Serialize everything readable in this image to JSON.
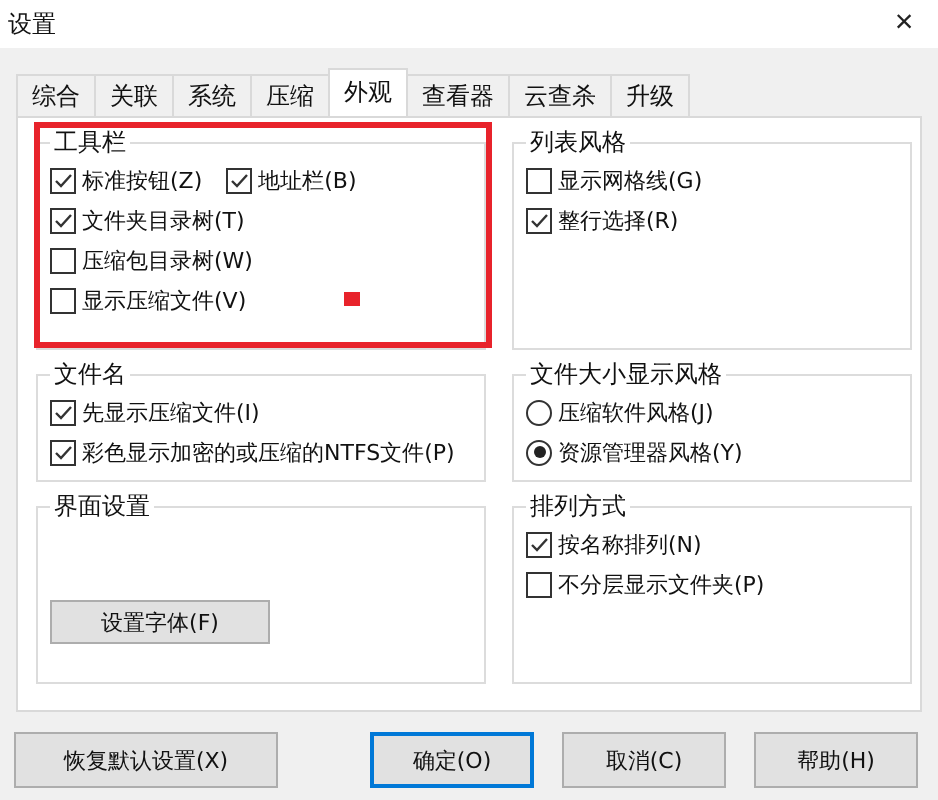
{
  "window": {
    "title": "设置",
    "close": "×"
  },
  "tabs": [
    {
      "label": "综合",
      "selected": false
    },
    {
      "label": "关联",
      "selected": false
    },
    {
      "label": "系统",
      "selected": false
    },
    {
      "label": "压缩",
      "selected": false
    },
    {
      "label": "外观",
      "selected": true
    },
    {
      "label": "查看器",
      "selected": false
    },
    {
      "label": "云查杀",
      "selected": false
    },
    {
      "label": "升级",
      "selected": false
    }
  ],
  "groups": [
    {
      "title": "工具栏",
      "kind": "checks",
      "rows": [
        [
          {
            "label": "标准按钮(Z)",
            "checked": true
          },
          {
            "label": "地址栏(B)",
            "checked": true
          }
        ],
        [
          {
            "label": "文件夹目录树(T)",
            "checked": true
          }
        ],
        [
          {
            "label": "压缩包目录树(W)",
            "checked": false
          }
        ],
        [
          {
            "label": "显示压缩文件(V)",
            "checked": false
          }
        ]
      ]
    },
    {
      "title": "列表风格",
      "kind": "checks",
      "rows": [
        [
          {
            "label": "显示网格线(G)",
            "checked": false
          }
        ],
        [
          {
            "label": "整行选择(R)",
            "checked": true
          }
        ]
      ]
    },
    {
      "title": "文件名",
      "kind": "checks",
      "rows": [
        [
          {
            "label": "先显示压缩文件(I)",
            "checked": true
          }
        ],
        [
          {
            "label": "彩色显示加密的或压缩的NTFS文件(P)",
            "checked": true
          }
        ]
      ]
    },
    {
      "title": "文件大小显示风格",
      "kind": "radios",
      "rows": [
        [
          {
            "label": "压缩软件风格(J)",
            "selected": false
          }
        ],
        [
          {
            "label": "资源管理器风格(Y)",
            "selected": true
          }
        ]
      ]
    },
    {
      "title": "界面设置",
      "kind": "button",
      "button": "设置字体(F)"
    },
    {
      "title": "排列方式",
      "kind": "checks",
      "rows": [
        [
          {
            "label": "按名称排列(N)",
            "checked": true
          }
        ],
        [
          {
            "label": "不分层显示文件夹(P)",
            "checked": false
          }
        ]
      ]
    }
  ],
  "buttons": [
    {
      "label": "恢复默认设置(X)",
      "default": false
    },
    {
      "label": "确定(O)",
      "default": true
    },
    {
      "label": "取消(C)",
      "default": false
    },
    {
      "label": "帮助(H)",
      "default": false
    }
  ]
}
